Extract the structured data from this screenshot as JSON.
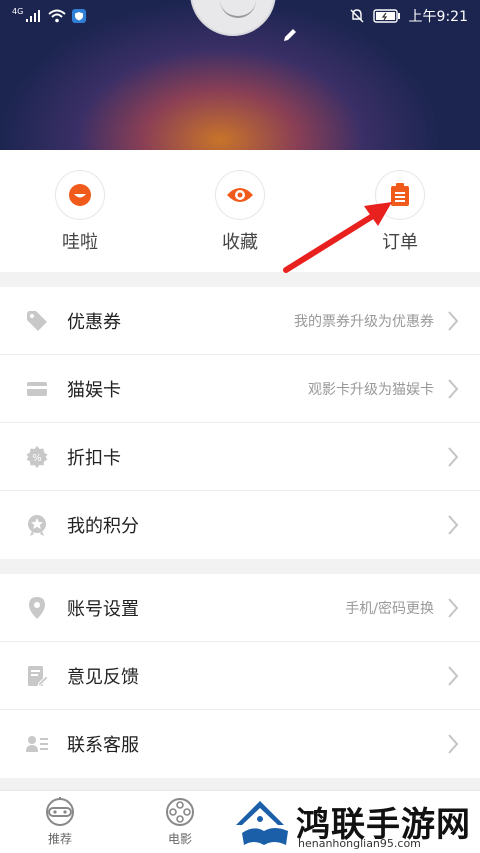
{
  "status_bar": {
    "network_label": "4G",
    "time": "上午9:21"
  },
  "quick_actions": [
    {
      "label": "哇啦",
      "icon": "smile-icon"
    },
    {
      "label": "收藏",
      "icon": "eye-icon"
    },
    {
      "label": "订单",
      "icon": "order-list-icon"
    }
  ],
  "menu_group_1": [
    {
      "label": "优惠券",
      "desc": "我的票券升级为优惠券",
      "icon": "tag-icon"
    },
    {
      "label": "猫娱卡",
      "desc": "观影卡升级为猫娱卡",
      "icon": "card-icon"
    },
    {
      "label": "折扣卡",
      "desc": "",
      "icon": "percent-badge-icon"
    },
    {
      "label": "我的积分",
      "desc": "",
      "icon": "star-badge-icon"
    }
  ],
  "menu_group_2": [
    {
      "label": "账号设置",
      "desc": "手机/密码更换",
      "icon": "location-pin-icon"
    },
    {
      "label": "意见反馈",
      "desc": "",
      "icon": "feedback-icon"
    },
    {
      "label": "联系客服",
      "desc": "",
      "icon": "contact-card-icon"
    }
  ],
  "bottom_nav": [
    {
      "label": "推荐",
      "icon": "robot-face-icon"
    },
    {
      "label": "电影",
      "icon": "film-reel-icon"
    }
  ],
  "watermark": {
    "title": "鸿联手游网",
    "url": "henanhonglian95.com"
  },
  "colors": {
    "accent": "#f05a1a",
    "arrow": "#e8211f"
  }
}
